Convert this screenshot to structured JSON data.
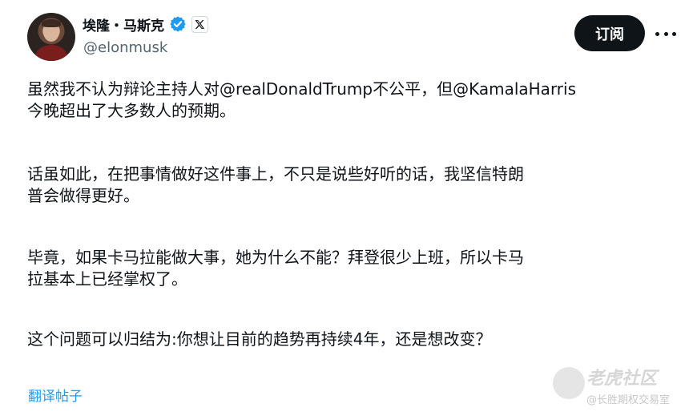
{
  "author": {
    "display_name": "埃隆・马斯克",
    "handle": "@elonmusk",
    "verified": true
  },
  "actions": {
    "subscribe_label": "订阅"
  },
  "tweet": {
    "paragraphs": [
      "虽然我不认为辩论主持人对@realDonaldTrump不公平，但@KamalaHarris\n今晚超出了大多数人的预期。",
      "话虽如此，在把事情做好这件事上，不只是说些好听的话，我坚信特朗\n普会做得更好。",
      "毕竟，如果卡马拉能做大事，她为什么不能？拜登很少上班，所以卡马\n拉基本上已经掌权了。",
      "这个问题可以归结为:你想让目前的趋势再持续4年，还是想改变？"
    ]
  },
  "footer": {
    "translate_label": "翻译帖子"
  },
  "watermark": {
    "title": "老虎社区",
    "subtitle": "@长胜期权交易室"
  },
  "colors": {
    "link": "#1d9bf0",
    "verified": "#1d9bf0",
    "button_bg": "#0f1419"
  }
}
